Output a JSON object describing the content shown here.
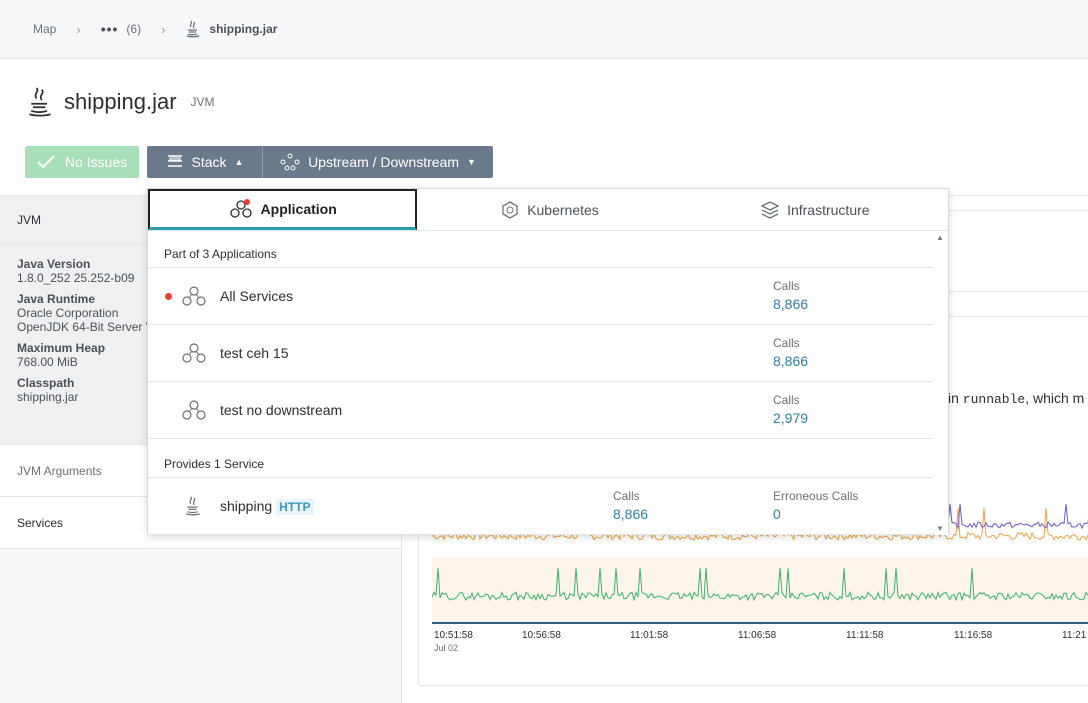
{
  "breadcrumb": {
    "root": "Map",
    "ellipsis": "•••",
    "count": "(6)",
    "current": "shipping.jar"
  },
  "header": {
    "title": "shipping.jar",
    "tag": "JVM"
  },
  "buttons": {
    "issues": "No Issues",
    "stack": "Stack",
    "updown": "Upstream / Downstream"
  },
  "sidebar": {
    "section": "JVM",
    "details": [
      {
        "label": "Java Version",
        "values": [
          "1.8.0_252 25.252-b09"
        ]
      },
      {
        "label": "Java Runtime",
        "values": [
          "Oracle Corporation",
          "OpenJDK 64-Bit Server V"
        ]
      },
      {
        "label": "Maximum Heap",
        "values": [
          "768.00 MiB"
        ]
      },
      {
        "label": "Classpath",
        "values": [
          "shipping.jar"
        ]
      }
    ],
    "jvm_args": "JVM Arguments",
    "services": "Services"
  },
  "panel": {
    "text_prefix": "in ",
    "text_code": "runnable",
    "text_suffix": ", which m"
  },
  "chart_data": {
    "type": "line",
    "x": [
      "10:51:58",
      "10:56:58",
      "11:01:58",
      "11:06:58",
      "11:11:58",
      "11:16:58",
      "11:21"
    ],
    "x_sub": "Jul 02",
    "series_colors": [
      "#6a5acd",
      "#f0a040",
      "#3bb36a"
    ]
  },
  "dropdown": {
    "tabs": [
      {
        "label": "Application",
        "icon": "application-icon"
      },
      {
        "label": "Kubernetes",
        "icon": "kubernetes-icon"
      },
      {
        "label": "Infrastructure",
        "icon": "infrastructure-icon"
      }
    ],
    "group1": "Part of 3 Applications",
    "apps": [
      {
        "name": "All Services",
        "calls_label": "Calls",
        "calls": "8,866",
        "alert": true
      },
      {
        "name": "test ceh 15",
        "calls_label": "Calls",
        "calls": "8,866",
        "alert": false
      },
      {
        "name": "test no downstream",
        "calls_label": "Calls",
        "calls": "2,979",
        "alert": false
      }
    ],
    "group2": "Provides 1 Service",
    "service": {
      "name": "shipping",
      "badge": "HTTP",
      "calls_label": "Calls",
      "calls": "8,866",
      "err_label": "Erroneous Calls",
      "err": "0"
    }
  },
  "colors": {
    "accent": "#2f9fb0",
    "success": "#a7dfb8",
    "button": "#6b7a8a",
    "link": "#2f7fa8",
    "alert": "#e8402a"
  }
}
